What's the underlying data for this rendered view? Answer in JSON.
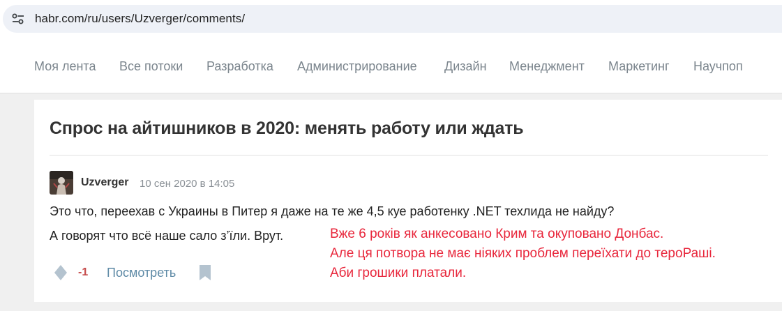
{
  "browser": {
    "url": "habr.com/ru/users/Uzverger/comments/",
    "site_icon": "tune-icon"
  },
  "nav": {
    "items": [
      {
        "label": "Моя лента"
      },
      {
        "label": "Все потоки"
      },
      {
        "label": "Разработка"
      },
      {
        "label": "Администрирование"
      },
      {
        "label": "Дизайн"
      },
      {
        "label": "Менеджмент"
      },
      {
        "label": "Маркетинг"
      },
      {
        "label": "Научпоп"
      }
    ]
  },
  "post": {
    "title": "Спрос на айтишников в 2020: менять работу или ждать"
  },
  "comment": {
    "author": "Uzverger",
    "timestamp": "10 сен 2020 в 14:05",
    "lines": [
      "Это что, переехав с Украины в Питер я даже на те же 4,5 куе работенку .NET техлида не найду?",
      "А говорят что всё наше сало з’їли. Врут."
    ],
    "score": "-1",
    "view_label": "Посмотреть"
  },
  "annotation": {
    "lines": [
      "Вже 6 років як анкесовано Крим та окуповано Донбас.",
      "Але ця потвора не має ніяких проблем переїхати до тероРаші.",
      "Аби грошики платали."
    ],
    "color": "#e8263b"
  },
  "colors": {
    "nav_text": "#7b858d",
    "link": "#5e8aa6",
    "score_negative": "#c54a4a"
  }
}
